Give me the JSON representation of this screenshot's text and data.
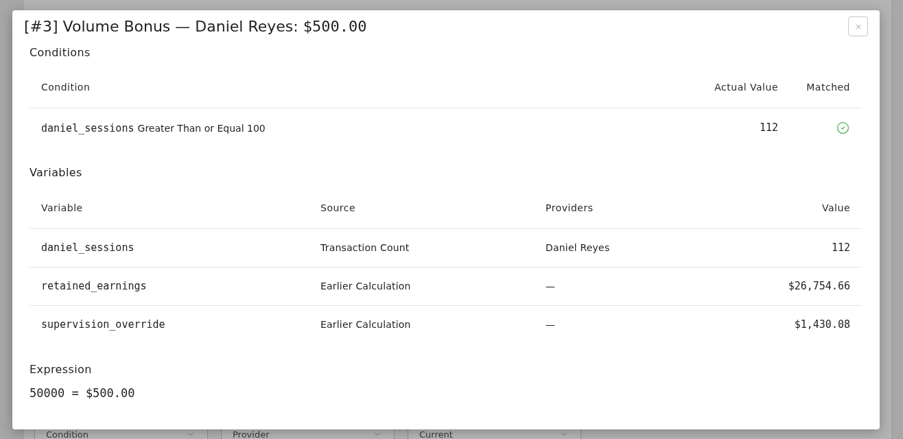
{
  "background_filters": [
    {
      "label": "Condition"
    },
    {
      "label": "Provider"
    },
    {
      "label": "Current"
    }
  ],
  "dialog": {
    "title": "[#3] Volume Bonus — Daniel Reyes:",
    "title_amount": "$500.00",
    "conditions": {
      "heading": "Conditions",
      "columns": [
        "Condition",
        "Actual Value",
        "Matched"
      ],
      "rows": [
        {
          "variable": "daniel_sessions",
          "operator": "Greater Than or Equal 100",
          "actual_value": "112",
          "matched": true
        }
      ]
    },
    "variables": {
      "heading": "Variables",
      "columns": [
        "Variable",
        "Source",
        "Providers",
        "Value"
      ],
      "rows": [
        {
          "variable": "daniel_sessions",
          "source": "Transaction Count",
          "providers": "Daniel Reyes",
          "value": "112"
        },
        {
          "variable": "retained_earnings",
          "source": "Earlier Calculation",
          "providers": "—",
          "value": "$26,754.66"
        },
        {
          "variable": "supervision_override",
          "source": "Earlier Calculation",
          "providers": "—",
          "value": "$1,430.08"
        }
      ]
    },
    "expression": {
      "heading": "Expression",
      "text": "50000 = $500.00"
    }
  }
}
